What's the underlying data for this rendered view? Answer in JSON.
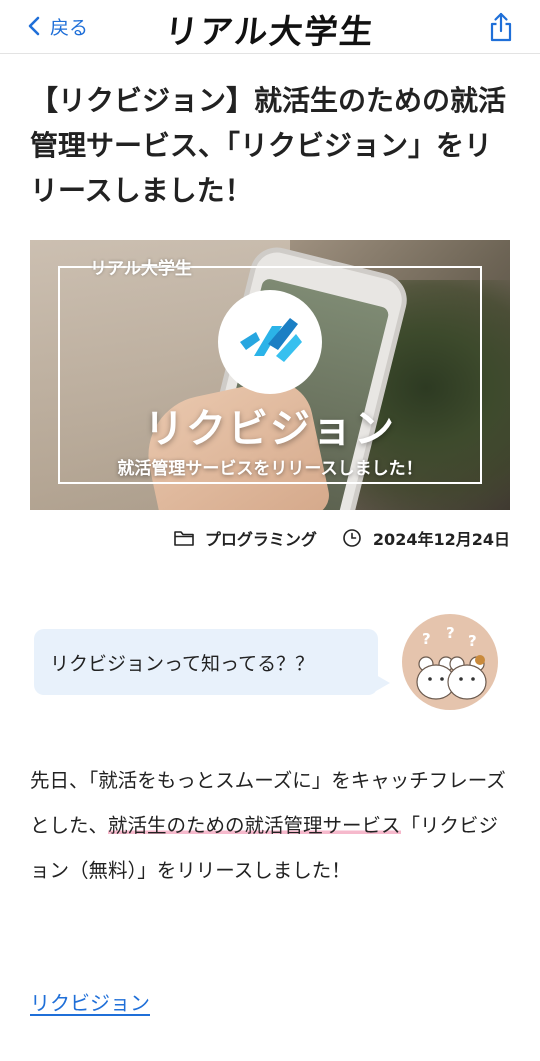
{
  "header": {
    "back_label": "戻る",
    "brand": "リアル大学生"
  },
  "article": {
    "title": "【リクビジョン】就活生のための就活管理サービス、「リクビジョン」をリリースしました！",
    "hero": {
      "frame_label": "リアル大学生",
      "headline": "リクビジョン",
      "subline": "就活管理サービスをリリースしました！"
    },
    "meta": {
      "category": "プログラミング",
      "date": "2024年12月24日"
    },
    "speech": {
      "text": "リクビジョンって知ってる？？"
    },
    "body": {
      "part1": "先日、「就活をもっとスムーズに」をキャッチフレーズとした、",
      "highlight": "就活生のための就活管理サービス",
      "part2": "「リクビジョン（無料）」をリリースしました！"
    },
    "link_label": "リクビジョン"
  },
  "colors": {
    "accent": "#1f6fd8",
    "bubble": "#e8f1fb",
    "highlight": "#f6b9cc"
  }
}
